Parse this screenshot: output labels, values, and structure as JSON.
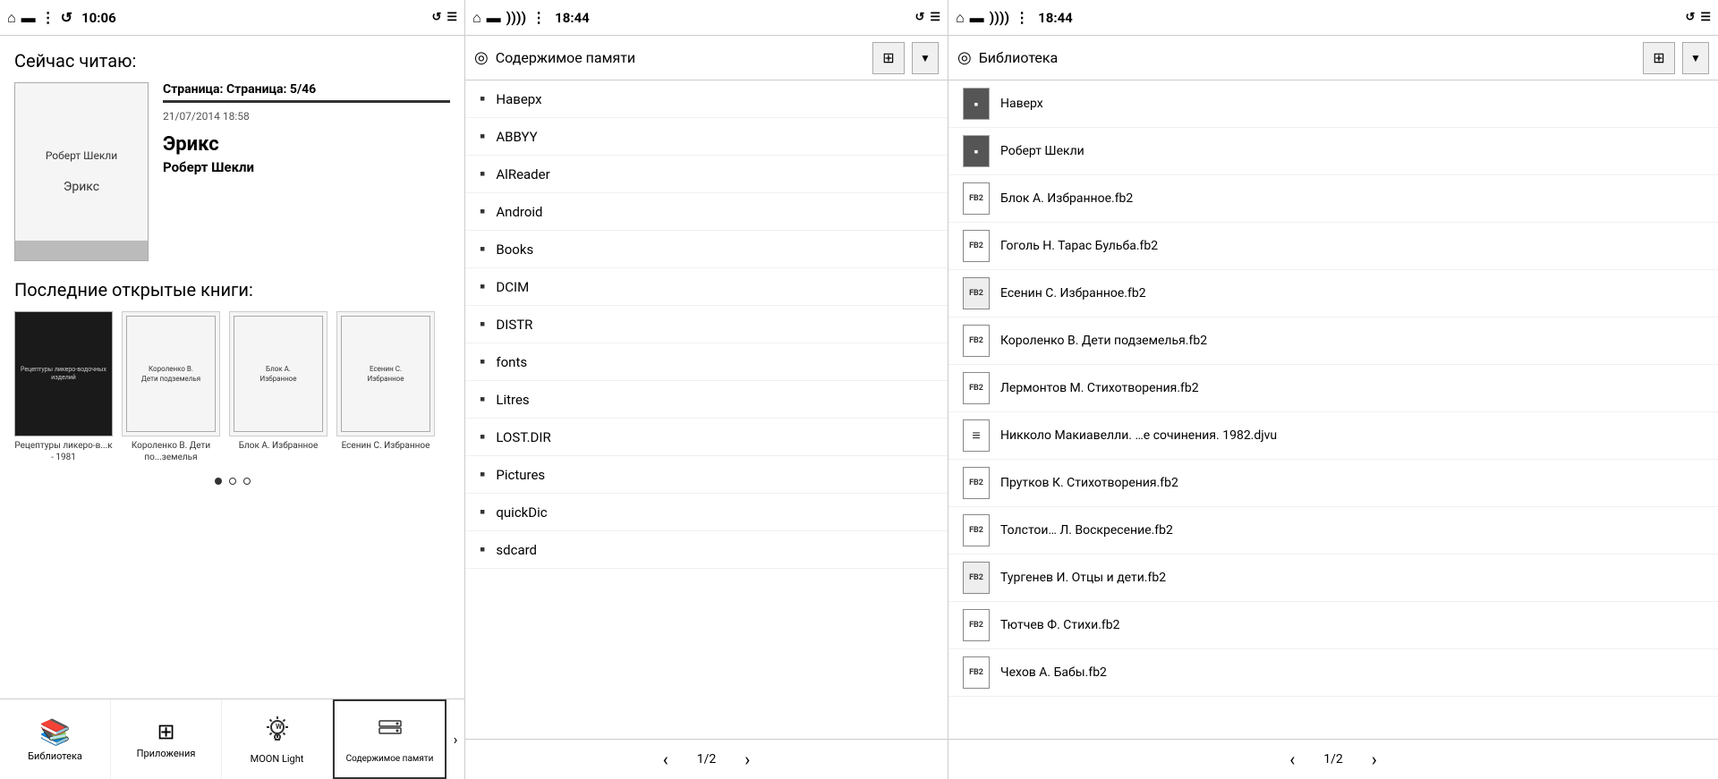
{
  "statusBars": [
    {
      "id": "bar1",
      "homeIcon": "🏠",
      "batteryIcon": "🔋",
      "dotsIcon": "⋮",
      "refreshIcon": "↺",
      "time": "10:06",
      "rightIcons": [
        "↺",
        "☰"
      ]
    },
    {
      "id": "bar2",
      "homeIcon": "🏠",
      "batteryIcon": "🔋",
      "wifiIcon": "📶",
      "dotsIcon": "⋮",
      "time": "18:44",
      "rightIcons": [
        "↺",
        "☰"
      ]
    },
    {
      "id": "bar3",
      "homeIcon": "🏠",
      "batteryIcon": "🔋",
      "wifiIcon": "📶",
      "dotsIcon": "⋮",
      "time": "18:44",
      "rightIcons": [
        "↺",
        "☰"
      ]
    }
  ],
  "home": {
    "currentlyReadingLabel": "Сейчас читаю:",
    "currentBook": {
      "authorTop": "Роберт  Шекли",
      "titleMiddle": "Эрикс",
      "pageInfo": "Страница: 5/46",
      "date": "21/07/2014 18:58",
      "title": "Эрикс",
      "author": "Роберт  Шекли"
    },
    "recentBooksLabel": "Последние открытые книги:",
    "recentBooks": [
      {
        "label": "Рецептуры ликеро-в...к - 1981",
        "dark": true,
        "coverText": "Рецептуры ликеро-водочных изделий"
      },
      {
        "label": "Короленко В. Дети по...земелья",
        "dark": false,
        "coverText": "Короленко В.\nДети подземелья"
      },
      {
        "label": "Блок А. Избранное",
        "dark": false,
        "coverText": "Блок А.\nИзбранное"
      },
      {
        "label": "Есенин С. Избранное",
        "dark": false,
        "coverText": "Есенин С.\nИзбранное"
      }
    ],
    "pagination": {
      "active": 0,
      "total": 3
    }
  },
  "bottomNav": [
    {
      "id": "library",
      "icon": "📚",
      "label": "Библиотека",
      "active": false
    },
    {
      "id": "apps",
      "icon": "⊞",
      "label": "Приложения",
      "active": false
    },
    {
      "id": "moonlight",
      "icon": "💡",
      "label": "MOON Light",
      "active": false
    },
    {
      "id": "storage",
      "icon": "🗄",
      "label": "Содержимое памяти",
      "active": true
    }
  ],
  "filePanel": {
    "headerIcon": "◎",
    "title": "Содержимое памяти",
    "gridIcon": "⊞",
    "dropdownIcon": "▼",
    "items": [
      {
        "name": "Наверх",
        "type": "folder"
      },
      {
        "name": "ABBYY",
        "type": "folder"
      },
      {
        "name": "AlReader",
        "type": "folder"
      },
      {
        "name": "Android",
        "type": "folder"
      },
      {
        "name": "Books",
        "type": "folder"
      },
      {
        "name": "DCIM",
        "type": "folder"
      },
      {
        "name": "DISTR",
        "type": "folder"
      },
      {
        "name": "fonts",
        "type": "folder"
      },
      {
        "name": "Litres",
        "type": "folder"
      },
      {
        "name": "LOST.DIR",
        "type": "folder"
      },
      {
        "name": "Pictures",
        "type": "folder"
      },
      {
        "name": "quickDic",
        "type": "folder"
      },
      {
        "name": "sdcard",
        "type": "folder"
      }
    ],
    "pagination": {
      "current": 1,
      "total": 2
    }
  },
  "libraryPanel": {
    "headerIcon": "◎",
    "title": "Библиотека",
    "gridIcon": "⊞",
    "dropdownIcon": "▼",
    "items": [
      {
        "name": "Наверх",
        "type": "folder-dark",
        "iconText": "📁"
      },
      {
        "name": "Роберт Шекли",
        "type": "folder-dark",
        "iconText": "📁"
      },
      {
        "name": "Блок А. Избранное.fb2",
        "type": "fb2",
        "iconText": "FB2"
      },
      {
        "name": "Гоголь Н. Тарас Бульба.fb2",
        "type": "fb2",
        "iconText": "FB2"
      },
      {
        "name": "Есенин С. Избранное.fb2",
        "type": "fb2-light",
        "iconText": "FB2"
      },
      {
        "name": "Короленко В. Дети подземелья.fb2",
        "type": "fb2",
        "iconText": "FB2"
      },
      {
        "name": "Лермонтов М. Стихотворения.fb2",
        "type": "fb2",
        "iconText": "FB2"
      },
      {
        "name": "Никколо Макиавелли. …е сочинения. 1982.djvu",
        "type": "djvu",
        "iconText": "≡"
      },
      {
        "name": "Прутков К. Стихотворения.fb2",
        "type": "fb2",
        "iconText": "FB2"
      },
      {
        "name": "Толстои… Л. Воскресение.fb2",
        "type": "fb2",
        "iconText": "FB2"
      },
      {
        "name": "Тургенев И. Отцы и дети.fb2",
        "type": "fb2-light",
        "iconText": "FB2"
      },
      {
        "name": "Тютчев Ф. Стихи.fb2",
        "type": "fb2",
        "iconText": "FB2"
      },
      {
        "name": "Чехов А. Бабы.fb2",
        "type": "fb2",
        "iconText": "FB2"
      }
    ],
    "pagination": {
      "current": 1,
      "total": 2
    }
  },
  "icons": {
    "home": "⌂",
    "battery": "▬",
    "wifi": "(((",
    "dots": "⋮",
    "refresh": "↺",
    "list": "☰",
    "folder": "▪",
    "back": "‹",
    "forward": "›",
    "grid": "⊞",
    "dropdown": "▼",
    "target": "◎"
  }
}
